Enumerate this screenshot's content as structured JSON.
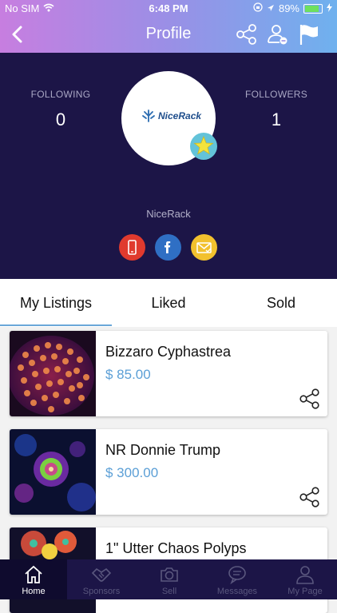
{
  "status_bar": {
    "carrier": "No SIM",
    "time": "6:48 PM",
    "battery": "89%"
  },
  "nav": {
    "title": "Profile"
  },
  "profile": {
    "following_label": "FOLLOWING",
    "following_count": "0",
    "followers_label": "FOLLOWERS",
    "followers_count": "1",
    "logo_text": "NiceRack",
    "username": "NiceRack",
    "social": [
      "phone-icon",
      "facebook-icon",
      "email-icon"
    ]
  },
  "tabs": [
    {
      "label": "My Listings",
      "selected": true
    },
    {
      "label": "Liked",
      "selected": false
    },
    {
      "label": "Sold",
      "selected": false
    }
  ],
  "listings": [
    {
      "name": "Bizzaro Cyphastrea",
      "price": "$ 85.00"
    },
    {
      "name": "NR Donnie Trump",
      "price": "$ 300.00"
    },
    {
      "name": "1\" Utter Chaos Polyps",
      "price": ""
    }
  ],
  "tabbar": [
    {
      "label": "Home",
      "icon": "home-icon",
      "active": true
    },
    {
      "label": "Sponsors",
      "icon": "handshake-icon",
      "active": false
    },
    {
      "label": "Sell",
      "icon": "camera-icon",
      "active": false
    },
    {
      "label": "Messages",
      "icon": "chat-bubble-icon",
      "active": false
    },
    {
      "label": "My Page",
      "icon": "person-icon",
      "active": false
    }
  ],
  "colors": {
    "profile_bg": "#1c1547",
    "accent": "#5b9fd6",
    "phone": "#e03a2e",
    "facebook": "#2f6fc4",
    "email": "#f2c12e"
  }
}
